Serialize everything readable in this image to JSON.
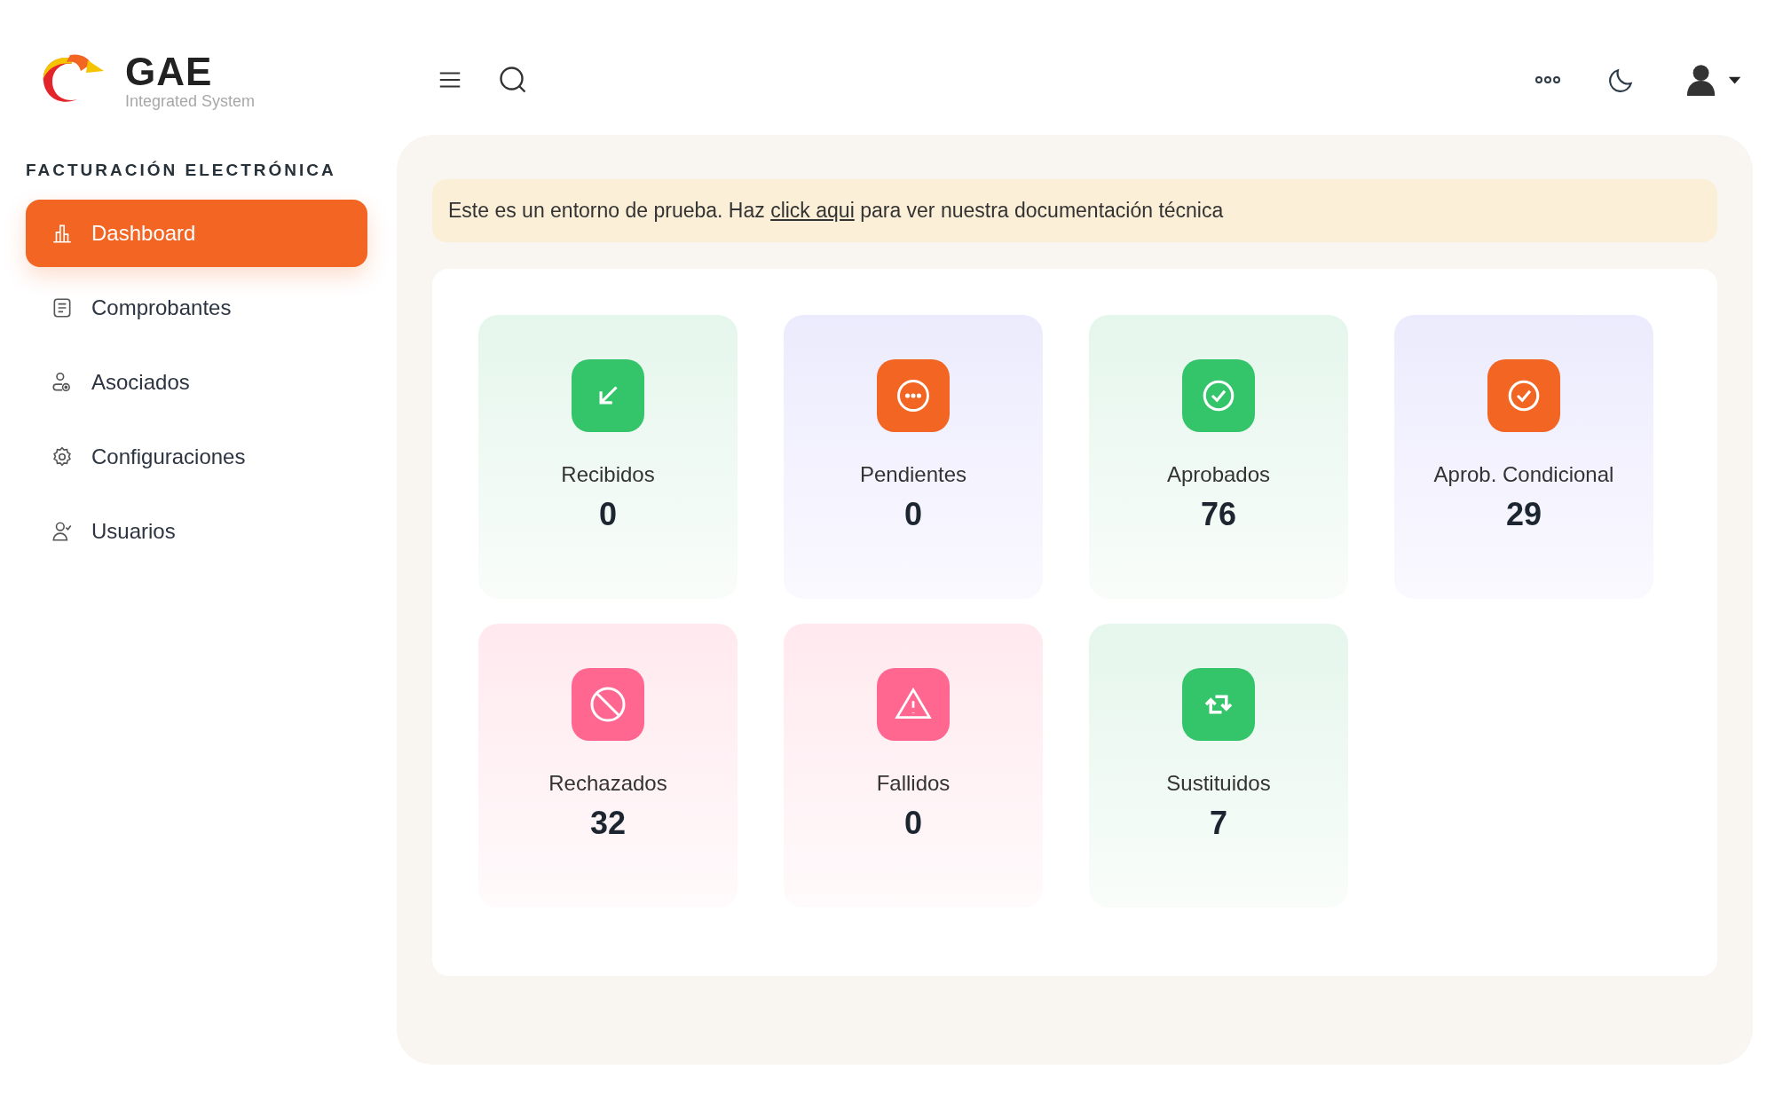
{
  "logo": {
    "name": "GAE",
    "tagline": "Integrated System"
  },
  "sidebar": {
    "section_title": "FACTURACIÓN ELECTRÓNICA",
    "items": [
      {
        "label": "Dashboard",
        "selected": true
      },
      {
        "label": "Comprobantes",
        "selected": false
      },
      {
        "label": "Asociados",
        "selected": false
      },
      {
        "label": "Configuraciones",
        "selected": false
      },
      {
        "label": "Usuarios",
        "selected": false
      }
    ]
  },
  "banner": {
    "before": "Este es un entorno de prueba. Haz ",
    "link": "click aqui",
    "after": " para ver nuestra documentación técnica"
  },
  "cards": [
    {
      "label": "Recibidos",
      "value": "0",
      "kind": "arrow",
      "color": "#34c46a"
    },
    {
      "label": "Pendientes",
      "value": "0",
      "kind": "dots",
      "color": "#f26522"
    },
    {
      "label": "Aprobados",
      "value": "76",
      "kind": "check",
      "color": "#34c46a"
    },
    {
      "label": "Aprob. Condicional",
      "value": "29",
      "kind": "check",
      "color": "#f26522"
    },
    {
      "label": "Rechazados",
      "value": "32",
      "kind": "ban",
      "color": "#ff6690"
    },
    {
      "label": "Fallidos",
      "value": "0",
      "kind": "warning",
      "color": "#ff6690"
    },
    {
      "label": "Sustituidos",
      "value": "7",
      "kind": "swap",
      "color": "#34c46a"
    }
  ]
}
